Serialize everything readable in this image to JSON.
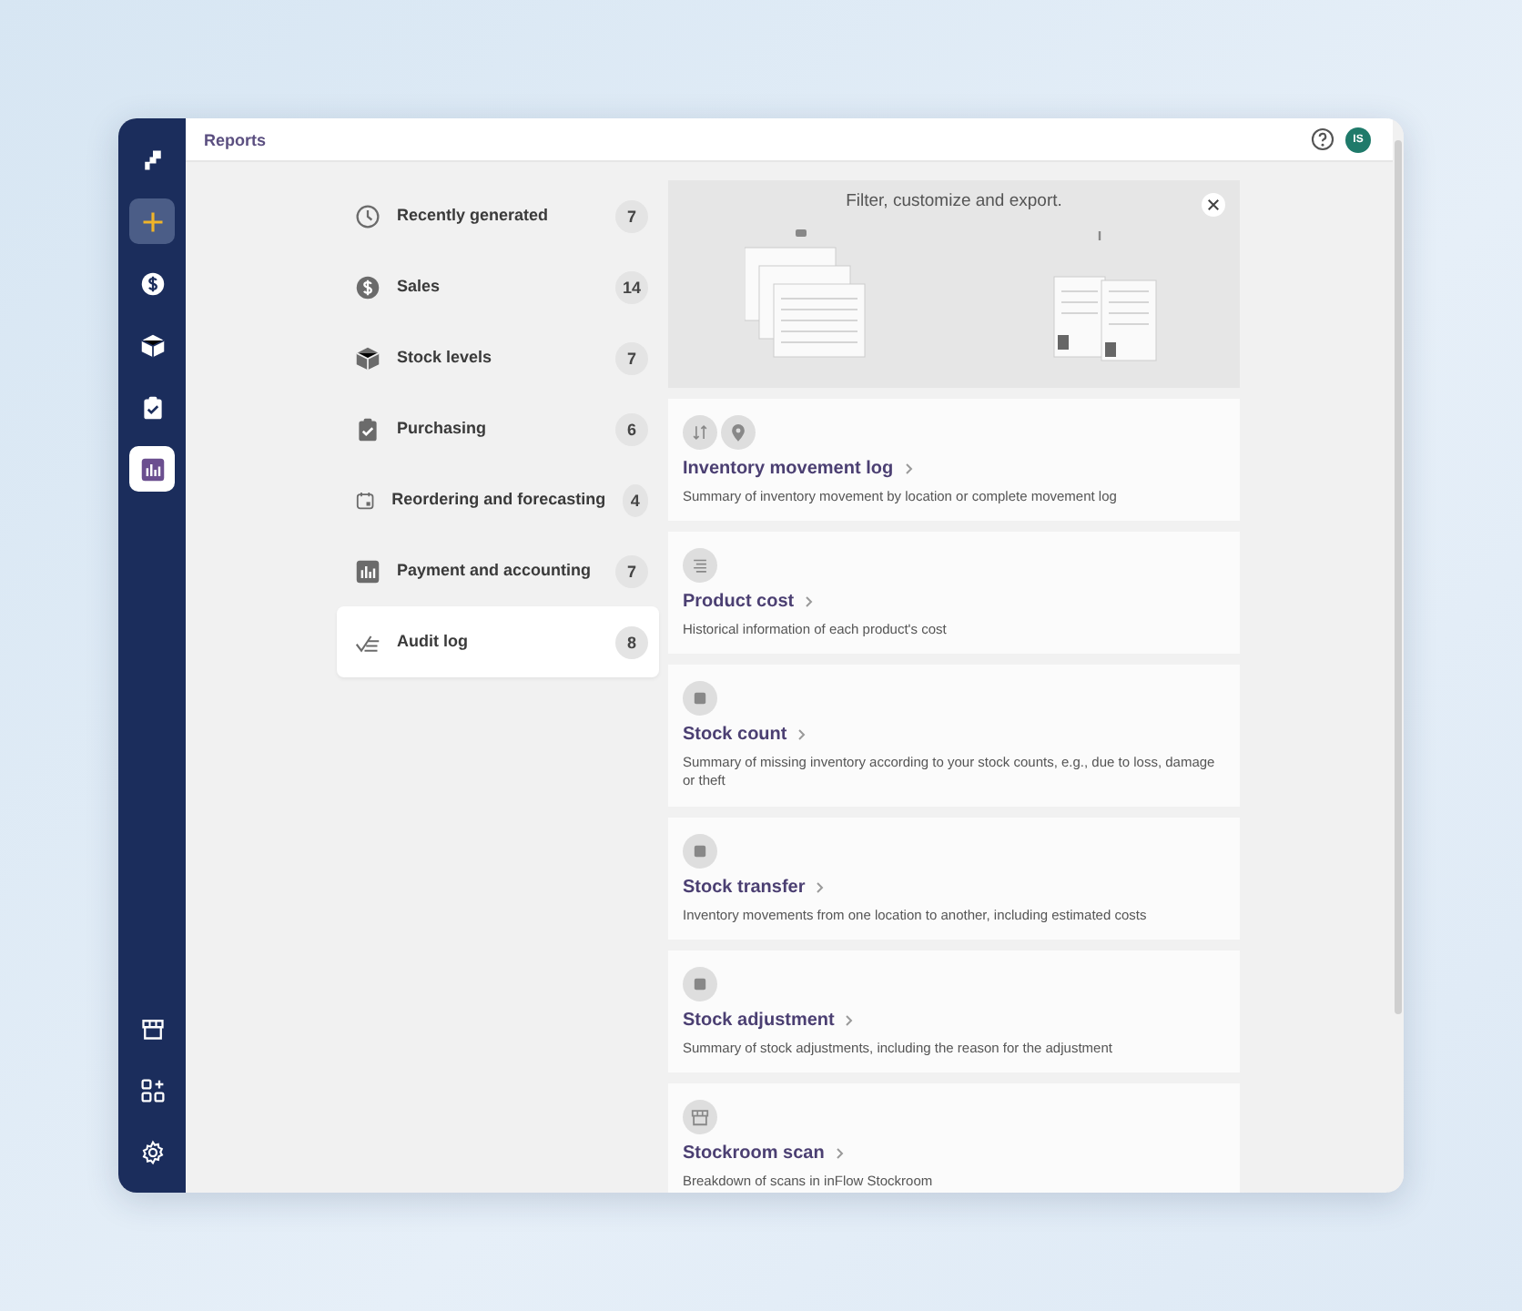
{
  "window": {
    "title": "Reports"
  },
  "nav": {
    "top": [
      {
        "kind": "logo",
        "selected": false
      },
      {
        "kind": "plus",
        "selected": false
      },
      {
        "kind": "dollar",
        "selected": false
      },
      {
        "kind": "box",
        "selected": false
      },
      {
        "kind": "clipboard",
        "selected": false
      },
      {
        "kind": "chart",
        "selected": true
      }
    ],
    "bottom": [
      {
        "kind": "store",
        "selected": false
      },
      {
        "kind": "apps",
        "selected": false
      },
      {
        "kind": "gear",
        "selected": false
      }
    ]
  },
  "header": {
    "avatar": "IS"
  },
  "categories": [
    {
      "kind": "clock",
      "label": "Recently generated",
      "count": "7",
      "selected": false
    },
    {
      "kind": "dollar",
      "label": "Sales",
      "count": "14",
      "selected": false
    },
    {
      "kind": "box",
      "label": "Stock levels",
      "count": "7",
      "selected": false
    },
    {
      "kind": "clipboard",
      "label": "Purchasing",
      "count": "6",
      "selected": false
    },
    {
      "kind": "calendar",
      "label": "Reordering and forecasting",
      "count": "4",
      "selected": false
    },
    {
      "kind": "chart",
      "label": "Payment and accounting",
      "count": "7",
      "selected": false
    },
    {
      "kind": "audit",
      "label": "Audit log",
      "count": "8",
      "selected": true
    }
  ],
  "banner": {
    "title": "Filter, customize and export."
  },
  "reports": [
    {
      "icons": [
        {
          "kind": "arrows"
        },
        {
          "kind": "pin"
        }
      ],
      "title": "Inventory movement log",
      "description": "Summary of inventory movement by location or complete movement log"
    },
    {
      "icons": [
        {
          "kind": "lines"
        }
      ],
      "title": "Product cost",
      "description": "Historical information of each product's cost"
    },
    {
      "icons": [
        {
          "kind": "square"
        }
      ],
      "title": "Stock count",
      "description": "Summary of missing inventory according to your stock counts, e.g., due to loss, damage or theft"
    },
    {
      "icons": [
        {
          "kind": "square"
        }
      ],
      "title": "Stock transfer",
      "description": "Inventory movements from one location to another, including estimated costs"
    },
    {
      "icons": [
        {
          "kind": "square"
        }
      ],
      "title": "Stock adjustment",
      "description": "Summary of stock adjustments, including the reason for the adjustment"
    },
    {
      "icons": [
        {
          "kind": "store"
        }
      ],
      "title": "Stockroom scan",
      "description": "Breakdown of scans in inFlow Stockroom"
    }
  ]
}
